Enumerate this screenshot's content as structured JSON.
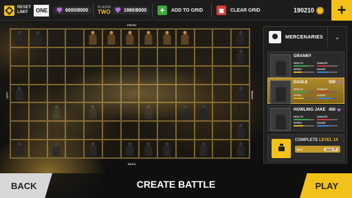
{
  "topbar": {
    "reset_label": "RESET\nLIMIT",
    "limit_value": "ONE",
    "player1_resources": "6000/8000",
    "player_label": "PLAYER",
    "player_value": "TWO",
    "player2_resources": "1980/8000",
    "add_to_grid": "ADD TO GRID",
    "clear_grid": "CLEAR GRID",
    "coins": "190210",
    "plus": "+"
  },
  "grid": {
    "cols": 13,
    "rows": 7,
    "front_label": "FRONT",
    "back_label": "BACK",
    "left_label": "LEFT",
    "right_label": "RIGHT",
    "player_units": [
      [
        0,
        0
      ],
      [
        0,
        1
      ],
      [
        0,
        12
      ],
      [
        1,
        12
      ],
      [
        3,
        12
      ],
      [
        4,
        2
      ],
      [
        4,
        4
      ],
      [
        4,
        7
      ],
      [
        4,
        9
      ],
      [
        4,
        10
      ],
      [
        6,
        0
      ],
      [
        6,
        2
      ],
      [
        6,
        4
      ],
      [
        6,
        6
      ],
      [
        6,
        7
      ],
      [
        6,
        8
      ],
      [
        6,
        10
      ],
      [
        6,
        12
      ],
      [
        3,
        0
      ],
      [
        5,
        12
      ]
    ],
    "enemy_units": [
      [
        0,
        4
      ],
      [
        0,
        5
      ],
      [
        0,
        6
      ],
      [
        0,
        7
      ],
      [
        0,
        8
      ],
      [
        0,
        9
      ]
    ]
  },
  "panel": {
    "title": "MERCENARIES",
    "dropdown_icon": "chevron-down-icon",
    "cards": [
      {
        "name": "GRANNY",
        "price": "",
        "selected": false,
        "stats": {
          "health": 0.7,
          "damage": 0.55,
          "speed": 0.4,
          "range": 0.5
        }
      },
      {
        "name": "EAGLE",
        "price": "350",
        "selected": true,
        "stats": {
          "health": 0.6,
          "damage": 0.65,
          "speed": 0.5,
          "range": 0.7
        }
      },
      {
        "name": "HOWLING JAKE",
        "price": "450",
        "selected": false,
        "stats": {
          "health": 0.75,
          "damage": 0.6,
          "speed": 0.45,
          "range": 0.55
        }
      }
    ],
    "stat_labels": {
      "health": "HEALTH",
      "damage": "DAMAGE",
      "speed": "SPEED",
      "range": "RANGE"
    },
    "complete_label": "COMPLETE",
    "complete_level": "LEVEL 14",
    "buy_label": "BUY",
    "buy_price": "3000"
  },
  "bottom": {
    "back": "BACK",
    "title": "CREATE BATTLE",
    "play": "PLAY"
  }
}
